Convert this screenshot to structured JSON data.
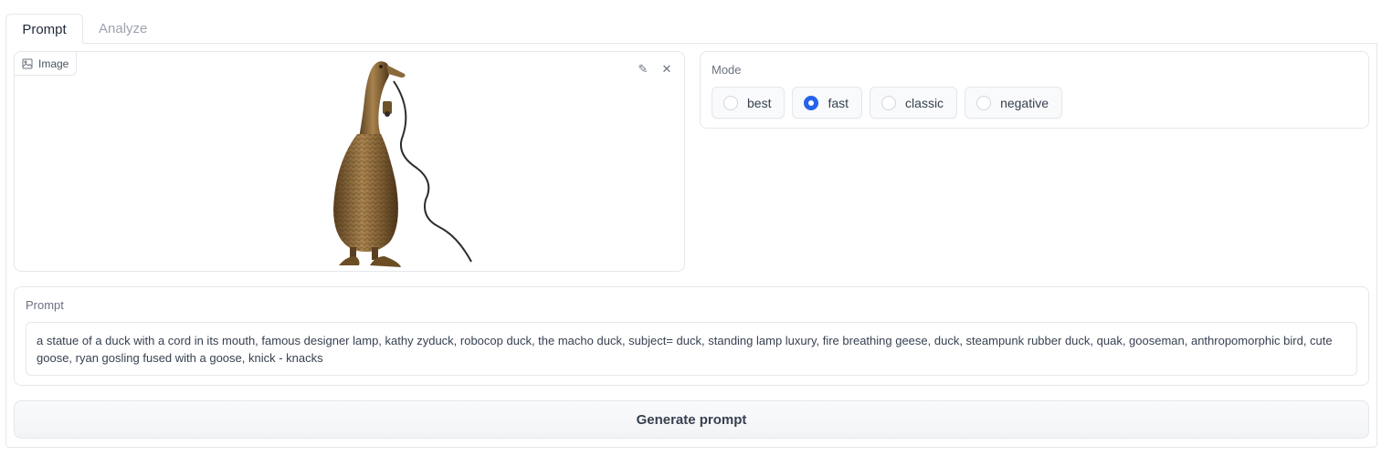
{
  "tabs": [
    {
      "label": "Prompt",
      "active": true
    },
    {
      "label": "Analyze",
      "active": false
    }
  ],
  "image": {
    "label": "Image",
    "icon": "image-icon",
    "tools": [
      "edit-icon",
      "close-icon"
    ]
  },
  "mode": {
    "title": "Mode",
    "options": [
      {
        "label": "best",
        "checked": false
      },
      {
        "label": "fast",
        "checked": true
      },
      {
        "label": "classic",
        "checked": false
      },
      {
        "label": "negative",
        "checked": false
      }
    ]
  },
  "prompt": {
    "title": "Prompt",
    "value": "a statue of a duck with a cord in its mouth, famous designer lamp, kathy zyduck, robocop duck, the macho duck, subject= duck, standing lamp luxury, fire breathing geese, duck, steampunk rubber duck, quak, gooseman, anthropomorphic bird, cute goose, ryan gosling fused with a goose, knick - knacks"
  },
  "generate_button": {
    "label": "Generate prompt"
  },
  "colors": {
    "accent": "#2563eb",
    "border": "#e5e7eb",
    "muted_text": "#9ca3af"
  }
}
